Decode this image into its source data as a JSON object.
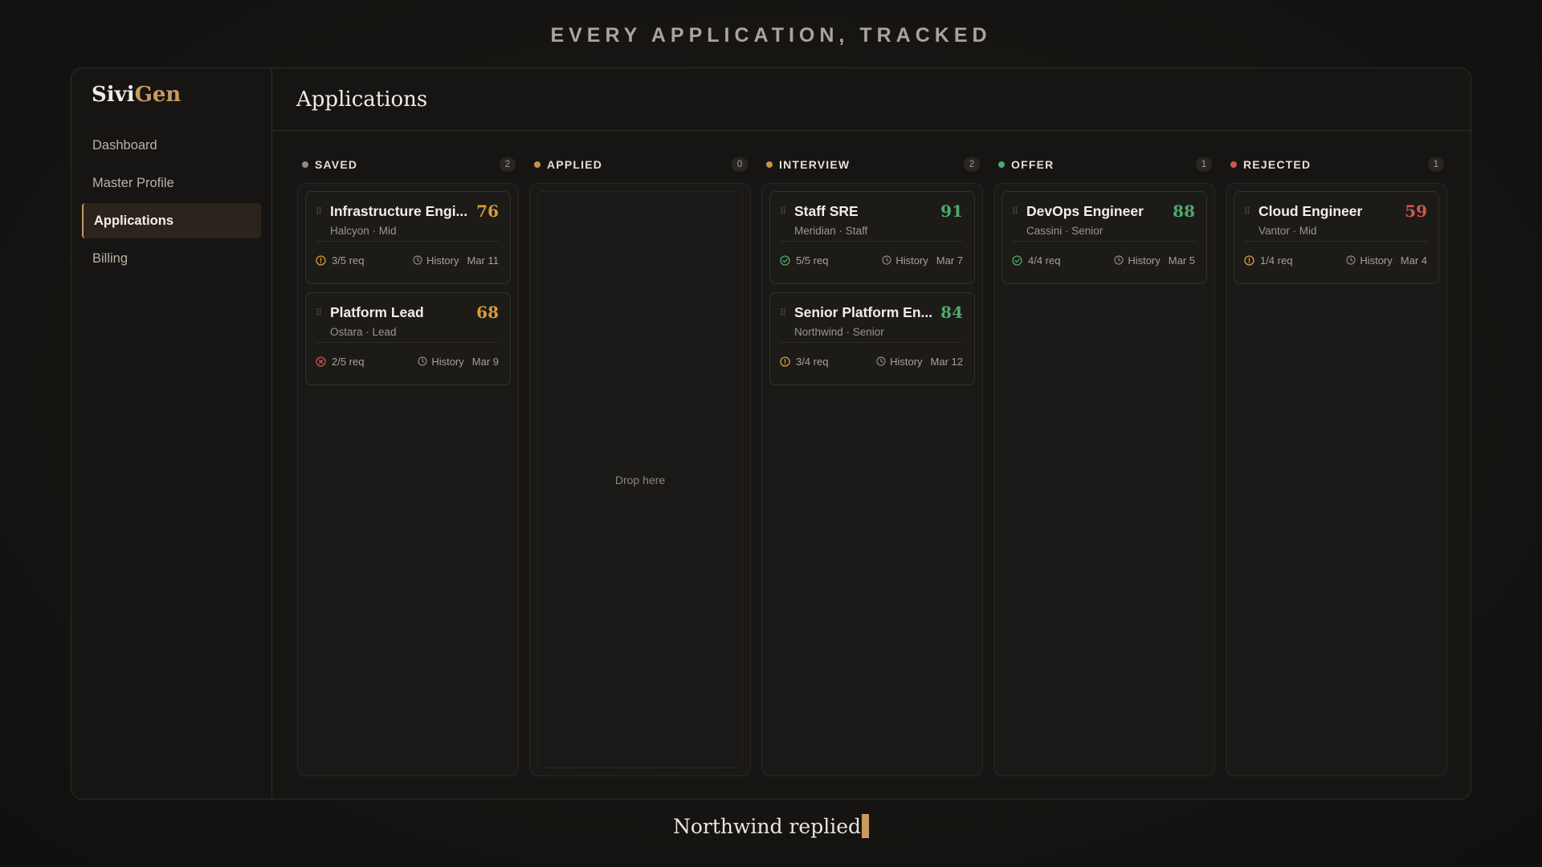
{
  "tagline": "EVERY APPLICATION, TRACKED",
  "brand": {
    "part1": "Sivi",
    "part2": "Gen",
    "accent_color": "#c89a5e"
  },
  "sidebar": {
    "items": [
      {
        "label": "Dashboard",
        "active": false
      },
      {
        "label": "Master Profile",
        "active": false
      },
      {
        "label": "Applications",
        "active": true
      },
      {
        "label": "Billing",
        "active": false
      }
    ]
  },
  "page_title": "Applications",
  "columns": [
    {
      "title": "SAVED",
      "count": "2",
      "dot_color": "#8f8a82",
      "cards": [
        {
          "title": "Infrastructure Engi...",
          "company": "Halcyon · Mid",
          "score": "76",
          "score_color": "#d99a3a",
          "req": "3/5 req",
          "req_status": "warn",
          "history": "History",
          "date": "Mar 11"
        },
        {
          "title": "Platform Lead",
          "company": "Ostara · Lead",
          "score": "68",
          "score_color": "#d99a3a",
          "req": "2/5 req",
          "req_status": "fail",
          "history": "History",
          "date": "Mar 9"
        }
      ]
    },
    {
      "title": "APPLIED",
      "count": "0",
      "dot_color": "#c8904a",
      "drop_label": "Drop here",
      "cards": []
    },
    {
      "title": "INTERVIEW",
      "count": "2",
      "dot_color": "#c8904a",
      "cards": [
        {
          "title": "Staff SRE",
          "company": "Meridian · Staff",
          "score": "91",
          "score_color": "#4faa6a",
          "req": "5/5 req",
          "req_status": "ok",
          "history": "History",
          "date": "Mar 7"
        },
        {
          "title": "Senior Platform En...",
          "company": "Northwind · Senior",
          "score": "84",
          "score_color": "#4faa6a",
          "req": "3/4 req",
          "req_status": "warn",
          "history": "History",
          "date": "Mar 12"
        }
      ]
    },
    {
      "title": "OFFER",
      "count": "1",
      "dot_color": "#4faa6a",
      "cards": [
        {
          "title": "DevOps Engineer",
          "company": "Cassini · Senior",
          "score": "88",
          "score_color": "#4faa6a",
          "req": "4/4 req",
          "req_status": "ok",
          "history": "History",
          "date": "Mar 5"
        }
      ]
    },
    {
      "title": "REJECTED",
      "count": "1",
      "dot_color": "#d2564a",
      "cards": [
        {
          "title": "Cloud Engineer",
          "company": "Vantor · Mid",
          "score": "59",
          "score_color": "#d2564a",
          "req": "1/4 req",
          "req_status": "warn",
          "history": "History",
          "date": "Mar 4"
        }
      ]
    }
  ],
  "status_colors": {
    "ok": "#4faa6a",
    "warn": "#d99a3a",
    "fail": "#d2564a"
  },
  "toast": "Northwind replied"
}
